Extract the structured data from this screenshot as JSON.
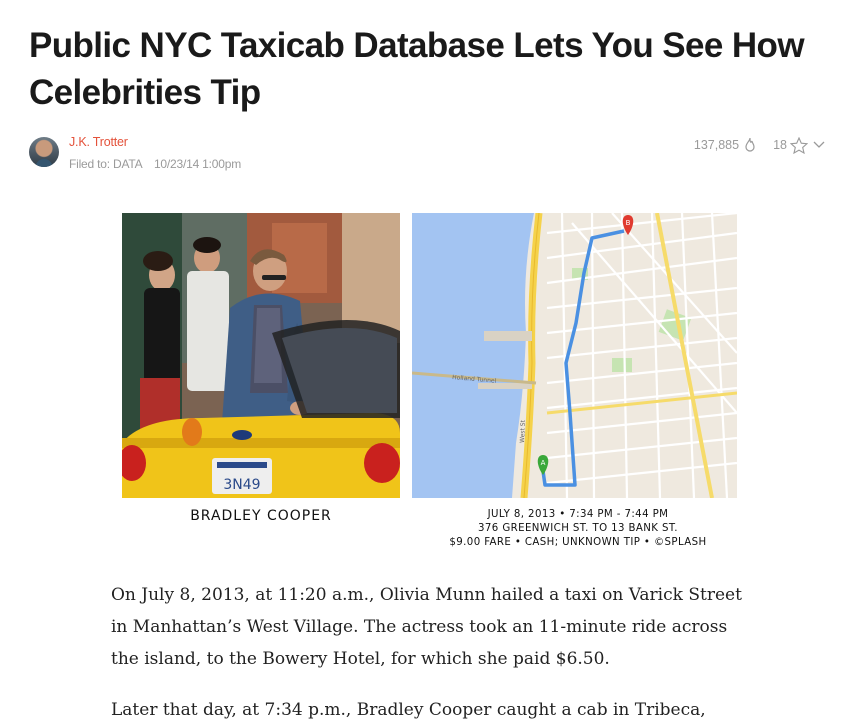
{
  "article": {
    "headline": "Public NYC Taxicab Database Lets You See How Celebrities Tip",
    "author": "J.K. Trotter",
    "filed_label": "Filed to:",
    "category": "DATA",
    "date": "10/23/14 1:00pm",
    "views": "137,885",
    "likes": "18"
  },
  "figure": {
    "photo_caption": "BRADLEY COOPER",
    "photo_plate": "3N49",
    "map_caption": [
      "JULY 8, 2013 • 7:34 PM - 7:44 PM",
      "376 GREENWICH ST. TO 13 BANK ST.",
      "$9.00 FARE • CASH; UNKNOWN TIP • ©SPLASH"
    ],
    "map_labels": {
      "holland_tunnel": "Holland Tunnel",
      "west_st": "West St",
      "start_marker": "A",
      "end_marker": "B"
    }
  },
  "body": {
    "paragraphs": [
      "On July 8, 2013, at 11:20 a.m., Olivia Munn hailed a taxi on Varick Street in Manhattan’s West Village. The actress took an 11-minute ride across the island, to the Bowery Hotel, for which she paid $6.50.",
      "Later that day, at 7:34 p.m., Bradley Cooper caught a cab in Tribeca,"
    ]
  },
  "colors": {
    "author": "#e4523b",
    "meta": "#9a9a9a",
    "route": "#4a90e2",
    "water": "#a3c4f2"
  },
  "icons": [
    "flame-icon",
    "star-icon",
    "chevron-down-icon"
  ]
}
